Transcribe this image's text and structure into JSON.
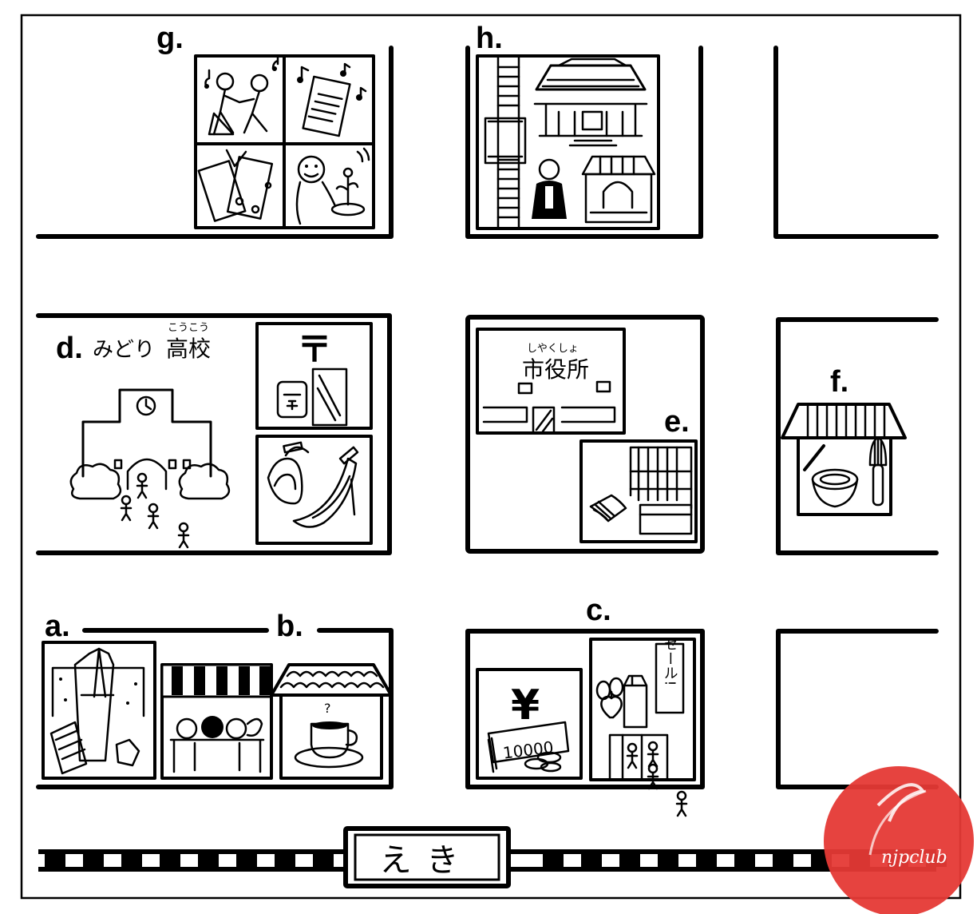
{
  "labels": {
    "a": "a.",
    "b": "b.",
    "c": "c.",
    "d": "d.",
    "e": "e.",
    "f": "f.",
    "g": "g.",
    "h": "h."
  },
  "school": {
    "name_prefix": "みどり",
    "name_kanji": "高校",
    "furigana": "こうこう"
  },
  "city_hall": {
    "name": "市役所",
    "furigana": "しやくしょ"
  },
  "station": {
    "name": "えき"
  },
  "supermarket": {
    "sale_sign": "セール!"
  },
  "bank": {
    "yen_symbol": "¥",
    "bill_text": "10000"
  },
  "post_office": {
    "symbol": "〒"
  },
  "cafe": {
    "steam": "?"
  },
  "watermark": {
    "text": "njpclub",
    "color": "#e53935"
  }
}
